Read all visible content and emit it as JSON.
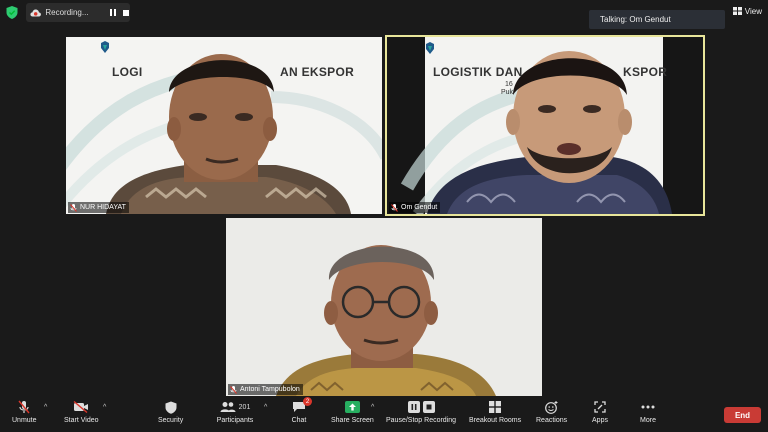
{
  "recording": {
    "label": "Recording..."
  },
  "view": {
    "label": "View"
  },
  "talking": {
    "text": "Talking: Om Gendut"
  },
  "participants_tiles": [
    {
      "name": "NUR HIDAYAT",
      "slide_title": "LOGI",
      "slide_title2": "AN EKSPOR"
    },
    {
      "name": "Om Gendut",
      "slide_title": "LOGISTIK DAN",
      "slide_title2": "KSPOR",
      "slide_sub1": "16",
      "slide_sub2": "Puk"
    },
    {
      "name": "Antoni Tampubolon"
    }
  ],
  "toolbar": {
    "unmute": "Unmute",
    "start_video": "Start Video",
    "security": "Security",
    "participants": "Participants",
    "participants_count": "201",
    "chat": "Chat",
    "chat_badge": "2",
    "share_screen": "Share Screen",
    "pause_stop_recording": "Pause/Stop Recording",
    "breakout_rooms": "Breakout Rooms",
    "reactions": "Reactions",
    "apps": "Apps",
    "more": "More",
    "end": "End"
  },
  "colors": {
    "active_speaker_border": "#e8e59a",
    "end_button": "#c93b35",
    "share_screen": "#27ae60",
    "security_shield": "#2ecc71"
  }
}
